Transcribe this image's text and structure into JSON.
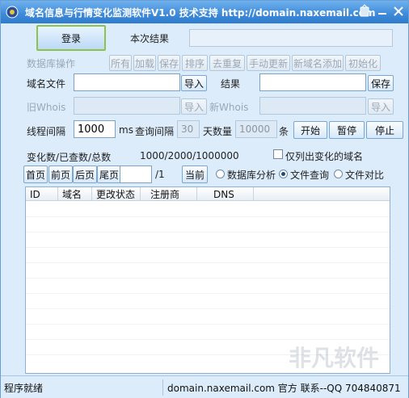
{
  "window": {
    "title": "域名信息与行情变化监测软件V1.0 技术支持 http://domain.naxemail.com"
  },
  "login": {
    "label": "登录"
  },
  "session_result": {
    "label": "本次结果",
    "value": ""
  },
  "db_ops": {
    "label": "数据库操作",
    "buttons": [
      "所有",
      "加载",
      "保存",
      "排序",
      "去重复",
      "手动更新",
      "新域名添加",
      "初始化"
    ]
  },
  "domain_file": {
    "label": "域名文件",
    "value": "",
    "import_label": "导入"
  },
  "result": {
    "label": "结果",
    "value": "",
    "save_label": "保存"
  },
  "old_whois": {
    "label": "旧Whois",
    "value": "",
    "import_label": "导入"
  },
  "new_whois": {
    "label": "新Whois",
    "value": "",
    "import_label": "导入"
  },
  "thread": {
    "label": "线程间隔",
    "value": "1000",
    "unit": "ms"
  },
  "query_interval": {
    "label": "查询间隔",
    "value": "30",
    "unit": "天"
  },
  "count": {
    "label": "数量",
    "value": "10000",
    "unit": "条"
  },
  "actions": {
    "start": "开始",
    "pause": "暂停",
    "stop": "停止"
  },
  "stats": {
    "label": "变化数/已查数/总数",
    "value": "1000/2000/1000000"
  },
  "only_changed": {
    "label": "仅列出变化的域名",
    "checked": false
  },
  "pager": {
    "first": "首页",
    "prev": "前页",
    "next": "后页",
    "last": "尾页",
    "page_value": "",
    "total": "/1",
    "current": "当前"
  },
  "mode": {
    "options": [
      "数据库分析",
      "文件查询",
      "文件对比"
    ],
    "selected": "文件查询"
  },
  "table": {
    "columns": [
      "ID",
      "域名",
      "更改状态",
      "注册商",
      "DNS"
    ]
  },
  "status": {
    "left": "程序就绪",
    "right": "domain.naxemail.com 官方 联系--QQ 704840871"
  },
  "watermark": "非凡软件",
  "colors": {
    "title_bar": "#3d8ad9",
    "window_bg": "#dcecfb",
    "login_border": "#8ec34b"
  }
}
